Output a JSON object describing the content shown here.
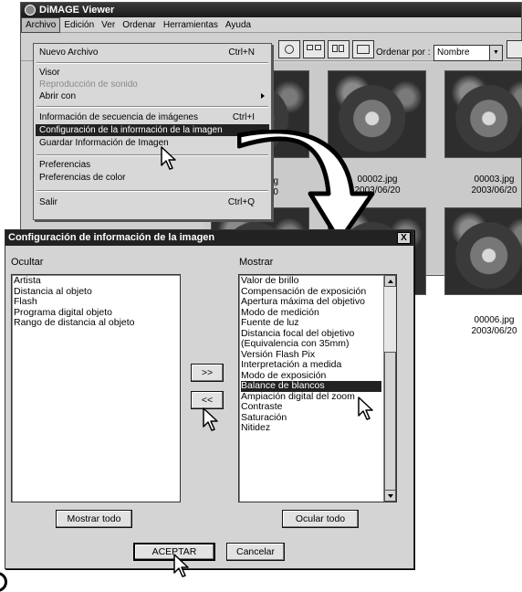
{
  "app": {
    "title": "DiMAGE Viewer"
  },
  "menubar": [
    "Archivo",
    "Edición",
    "Ver",
    "Ordenar",
    "Herramientas",
    "Ayuda"
  ],
  "toolbar": {
    "sort_label": "Ordenar por :",
    "sort_value": "Nombre"
  },
  "thumbnails": [
    {
      "name": "",
      "date": ""
    },
    {
      "name": "00002.jpg",
      "date": "2003/06/20"
    },
    {
      "name": "00003.jpg",
      "date": "2003/06/20"
    },
    {
      "name": "",
      "date": ""
    },
    {
      "name": "",
      "date": ""
    },
    {
      "name": "00006.jpg",
      "date": "2003/06/20"
    }
  ],
  "thumb_partial": {
    "name": "g",
    "date": "20"
  },
  "archivo_menu": {
    "items": [
      {
        "label": "Nuevo Archivo",
        "shortcut": "Ctrl+N"
      },
      {
        "label": "Visor",
        "shortcut": ""
      },
      {
        "label": "Reproducción de sonido",
        "shortcut": "",
        "disabled": true
      },
      {
        "label": "Abrir con",
        "shortcut": "",
        "submenu": true
      },
      {
        "label": "Información de secuencia de imágenes",
        "shortcut": "Ctrl+I"
      },
      {
        "label": "Configuración de la información de la imagen",
        "shortcut": "",
        "selected": true
      },
      {
        "label": "Guardar Información de Imagen",
        "shortcut": ""
      },
      {
        "label": "Preferencias",
        "shortcut": ""
      },
      {
        "label": "Preferencias de color",
        "shortcut": ""
      },
      {
        "label": "Salir",
        "shortcut": "Ctrl+Q"
      }
    ]
  },
  "dialog": {
    "title": "Configuración de información de la imagen",
    "close": "X",
    "hide_label": "Ocultar",
    "show_label": "Mostrar",
    "hidden_items": [
      "Artista",
      "Distancia al objeto",
      "Flash",
      "Programa digital objeto",
      "Rango de distancia al objeto"
    ],
    "shown_items": [
      "Valor de brillo",
      "Compensación de exposición",
      "Apertura máxima del objetivo",
      "Modo de medición",
      "Fuente de luz",
      "Distancia focal del objetivo",
      "(Equivalencia con 35mm)",
      "Versión Flash Pix",
      "Interpretación a medida",
      "Modo de exposición",
      "Balance de blancos",
      "Ampiación digital del zoom",
      "Contraste",
      "Saturación",
      "Nitidez"
    ],
    "selected_shown": "Balance de blancos",
    "move_right": ">>",
    "move_left": "<<",
    "show_all": "Mostrar todo",
    "hide_all": "Ocular todo",
    "ok": "ACEPTAR",
    "cancel": "Cancelar"
  }
}
